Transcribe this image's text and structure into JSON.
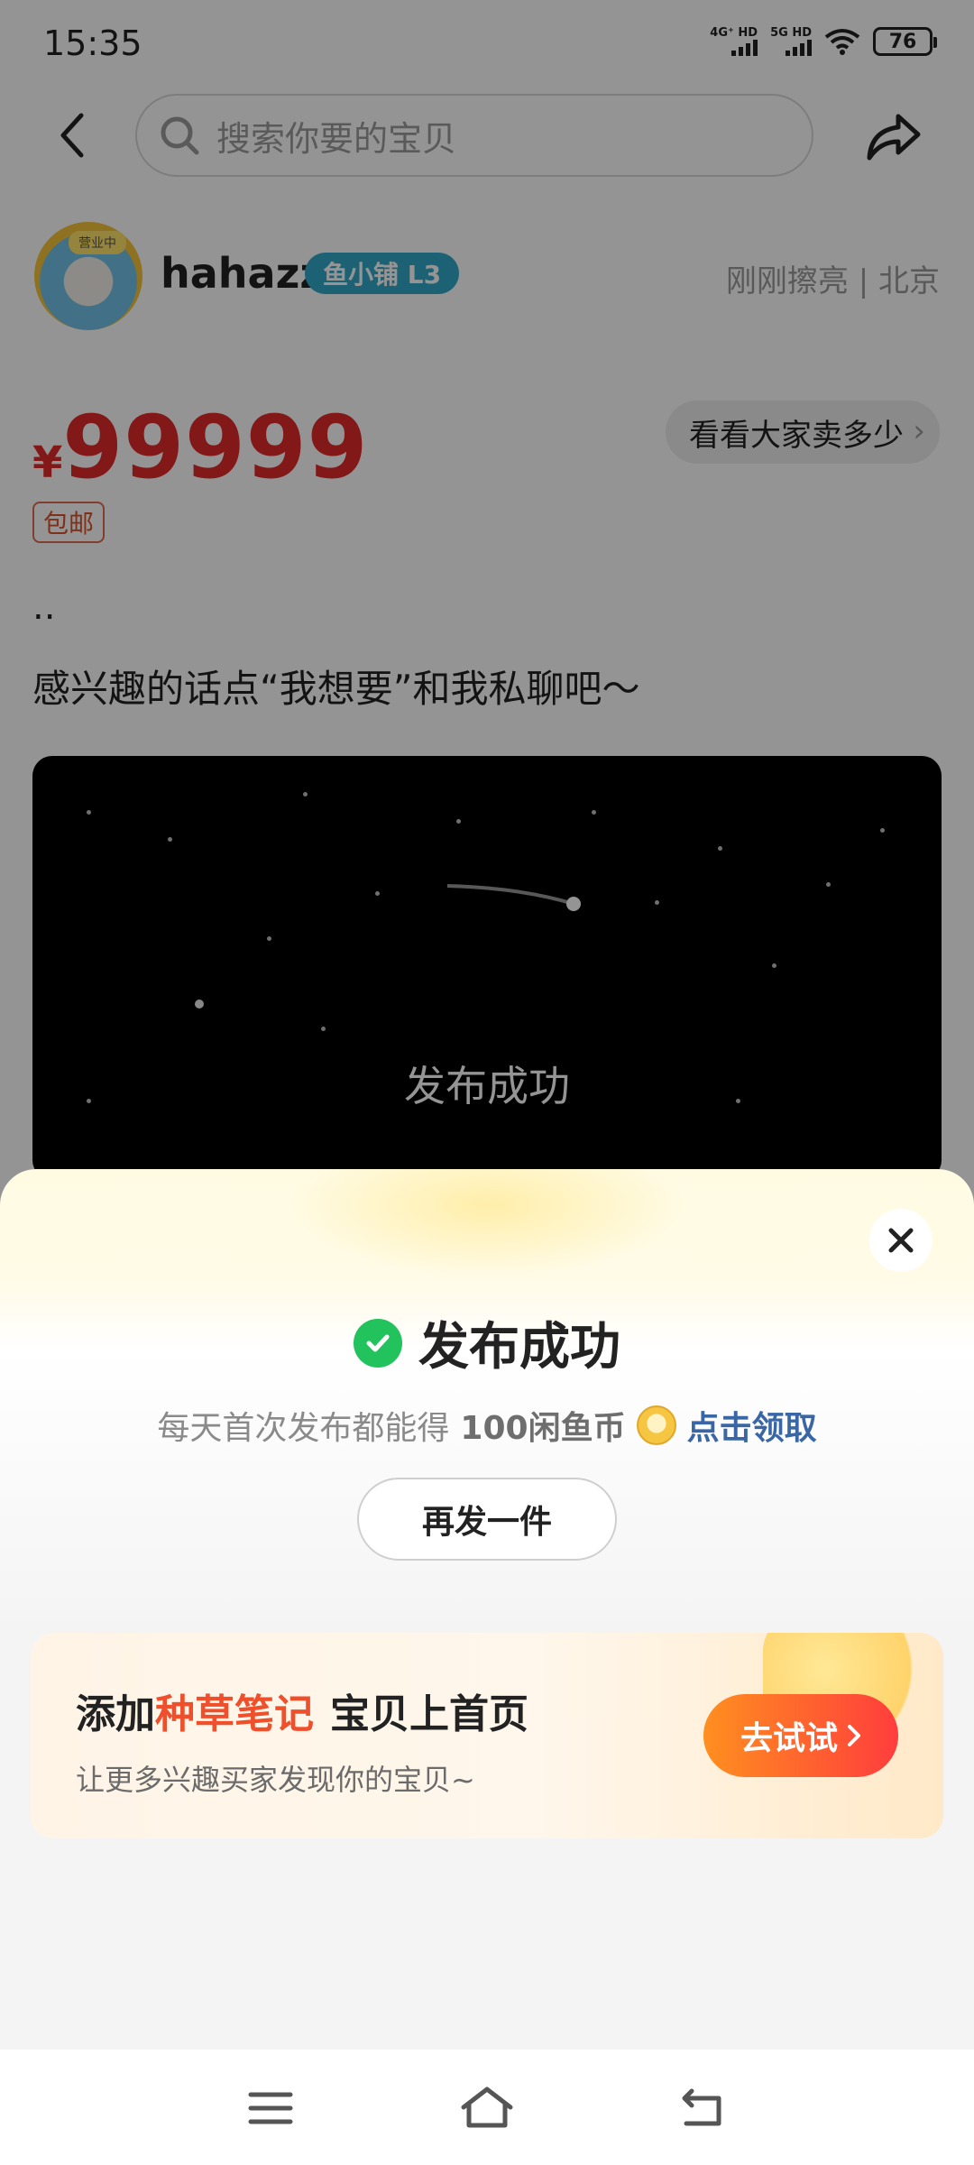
{
  "status_bar": {
    "time": "15:35",
    "network_1": "4G⁺ HD",
    "network_2": "5G HD",
    "battery": "76"
  },
  "search": {
    "placeholder": "搜索你要的宝贝"
  },
  "seller": {
    "avatar_tag": "营业中",
    "name": "hahazz",
    "level_badge": "鱼小铺 L3",
    "meta": "刚刚擦亮 | 北京"
  },
  "listing": {
    "currency": "¥",
    "price": "99999",
    "peers_button": "看看大家卖多少",
    "shipping_badge": "包邮",
    "desc_line1": "..",
    "desc_line2": "感兴趣的话点“我想要”和我私聊吧～",
    "video_caption": "发布成功"
  },
  "sheet": {
    "title": "发布成功",
    "reward_text": "每天首次发布都能得",
    "reward_amount": "100闲鱼币",
    "claim_link": "点击领取",
    "again_button": "再发一件",
    "promo": {
      "title_prefix": "添加",
      "title_highlight": "种草笔记",
      "title_suffix": "宝贝上首页",
      "subtitle": "让更多兴趣买家发现你的宝贝~",
      "button": "去试试"
    }
  },
  "colors": {
    "price_red": "#e02a2a",
    "success_green": "#22c25c",
    "claim_blue": "#3a66a6",
    "promo_orange": "#f04f2c",
    "level_badge": "#33a9c8"
  },
  "icons": [
    "back-arrow-icon",
    "search-icon",
    "share-icon",
    "close-icon",
    "check-circle-icon",
    "coin-icon",
    "chevron-right-icon",
    "menu-icon",
    "home-icon",
    "back-nav-icon"
  ]
}
